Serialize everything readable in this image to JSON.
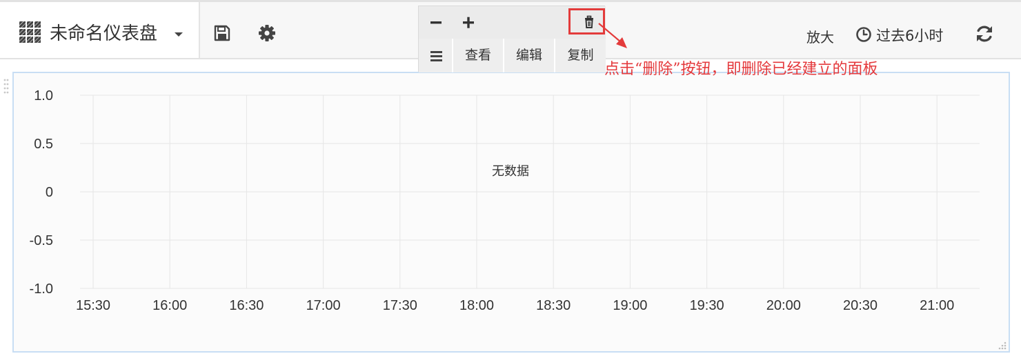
{
  "navbar": {
    "dashboard_title": "未命名仪表盘",
    "zoom_label": "放大",
    "time_range": "过去6小时",
    "icons": {
      "dashboard": "grid-icon",
      "dropdown": "caret-down-icon",
      "save": "save-icon",
      "settings": "gear-icon",
      "clock": "clock-icon",
      "refresh": "refresh-icon"
    }
  },
  "panel_menu": {
    "icons": {
      "collapse": "minus-icon",
      "expand": "plus-icon",
      "delete": "trash-icon",
      "menu": "hamburger-icon"
    },
    "actions": [
      "查看",
      "编辑",
      "复制"
    ]
  },
  "annotation": {
    "text": "点击“删除”按钮，即删除已经建立的面板",
    "color": "#e4393c"
  },
  "panel": {
    "no_data": "无数据",
    "border_color": "#c8def4"
  },
  "chart_data": {
    "type": "line",
    "series": [],
    "x_ticks": [
      "15:30",
      "16:00",
      "16:30",
      "17:00",
      "17:30",
      "18:00",
      "18:30",
      "19:00",
      "19:30",
      "20:00",
      "20:30",
      "21:00"
    ],
    "y_ticks": [
      "1.0",
      "0.5",
      "0",
      "-0.5",
      "-1.0"
    ],
    "ylim": [
      -1.0,
      1.0
    ],
    "grid": true,
    "legend": "none"
  }
}
